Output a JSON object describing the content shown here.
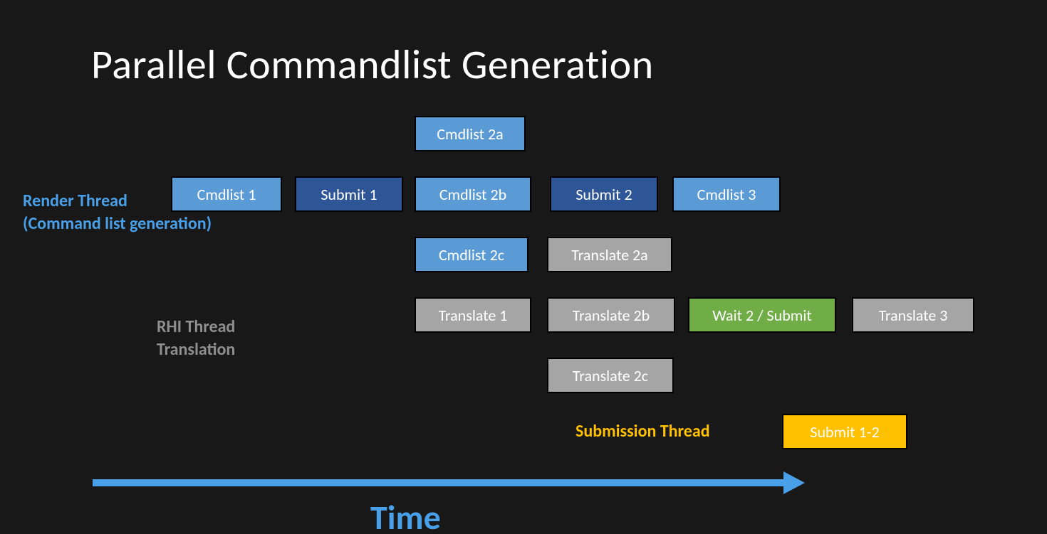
{
  "title": "Parallel Commandlist Generation",
  "labels": {
    "render_thread_l1": "Render Thread",
    "render_thread_l2": "(Command list generation)",
    "rhi_thread_l1": "RHI Thread",
    "rhi_thread_l2": "Translation",
    "submission_thread": "Submission Thread",
    "time": "Time"
  },
  "boxes": {
    "cmdlist1": "Cmdlist 1",
    "submit1": "Submit 1",
    "cmdlist2a": "Cmdlist 2a",
    "cmdlist2b": "Cmdlist 2b",
    "cmdlist2c": "Cmdlist 2c",
    "submit2": "Submit 2",
    "cmdlist3": "Cmdlist 3",
    "translate1": "Translate 1",
    "translate2a": "Translate 2a",
    "translate2b": "Translate 2b",
    "translate2c": "Translate 2c",
    "wait2submit": "Wait 2 / Submit",
    "translate3": "Translate 3",
    "submit12": "Submit 1-2"
  },
  "colors": {
    "bg": "#181818",
    "light_blue": "#5b9bd5",
    "dark_blue": "#2e5596",
    "grey": "#a5a5a5",
    "green": "#70ad47",
    "gold": "#ffc000",
    "accent_blue": "#4aa0e8"
  }
}
